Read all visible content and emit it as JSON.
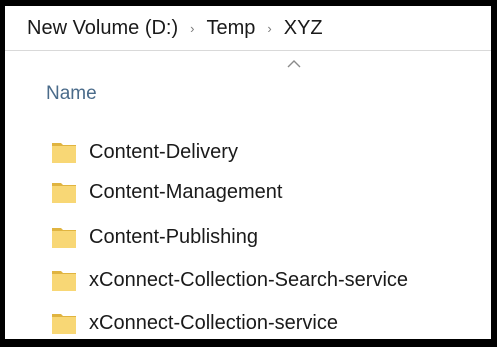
{
  "breadcrumb": {
    "items": [
      "New Volume (D:)",
      "Temp",
      "XYZ"
    ],
    "separator": "›"
  },
  "columns": {
    "name_label": "Name",
    "sort_icon": "chevron-up-icon"
  },
  "folders": [
    {
      "name": "Content-Delivery"
    },
    {
      "name": "Content-Management"
    },
    {
      "name": "Content-Publishing"
    },
    {
      "name": "xConnect-Collection-Search-service"
    },
    {
      "name": "xConnect-Collection-service"
    }
  ],
  "colors": {
    "folder_body": "#f8d775",
    "folder_edge": "#e0b440",
    "header_text": "#4a6b8a"
  }
}
